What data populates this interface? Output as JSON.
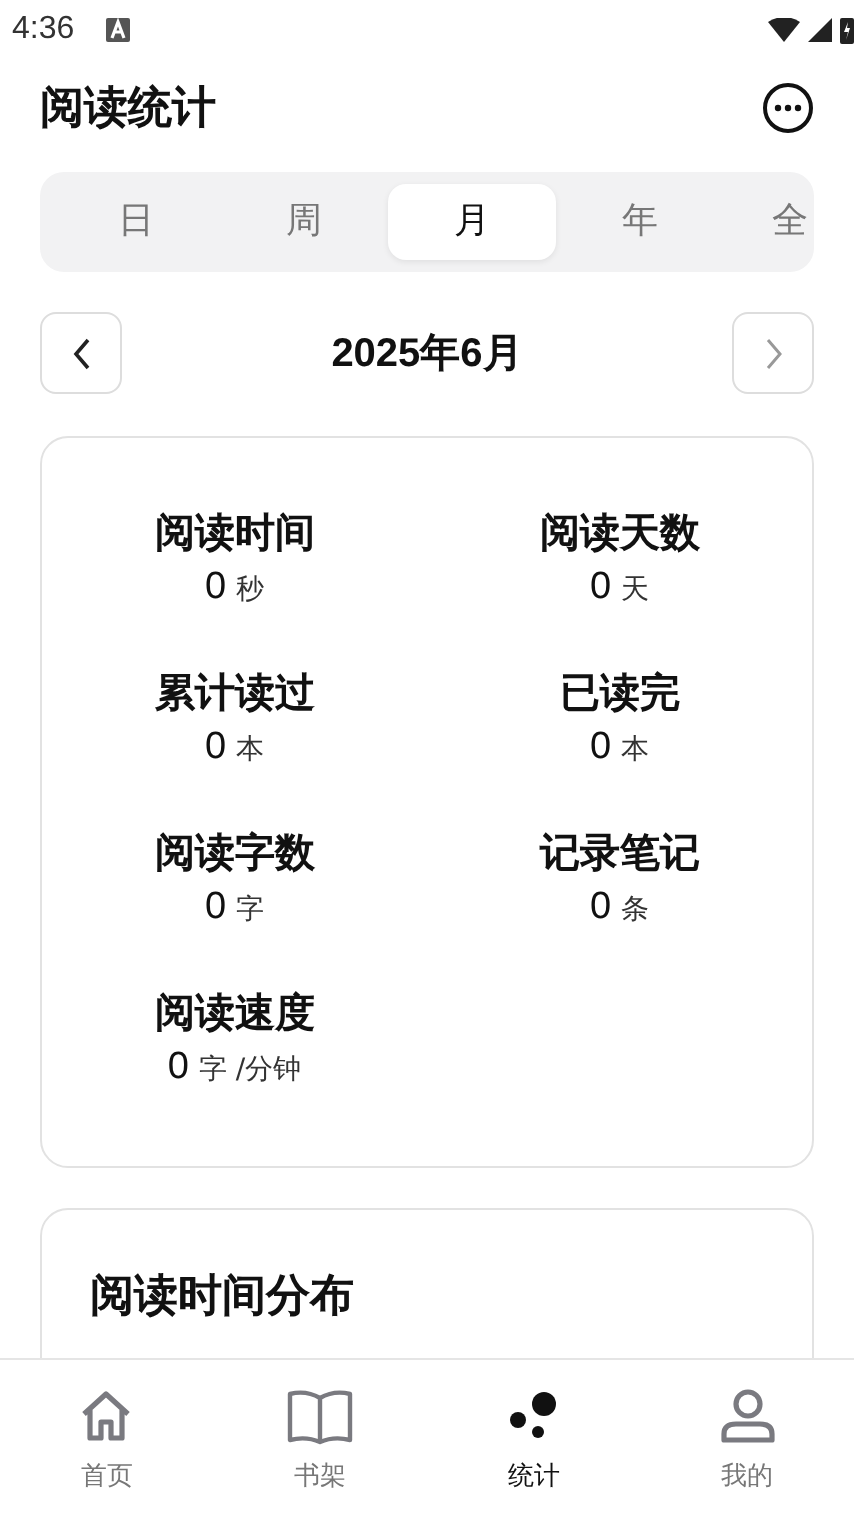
{
  "status_bar": {
    "time": "4:36"
  },
  "header": {
    "title": "阅读统计"
  },
  "period_tabs": [
    {
      "label": "日",
      "selected": false
    },
    {
      "label": "周",
      "selected": false
    },
    {
      "label": "月",
      "selected": true
    },
    {
      "label": "年",
      "selected": false
    },
    {
      "label": "全",
      "selected": false
    }
  ],
  "period_nav": {
    "title": "2025年6月"
  },
  "stats": [
    {
      "label": "阅读时间",
      "value": "0",
      "unit": "秒"
    },
    {
      "label": "阅读天数",
      "value": "0",
      "unit": "天"
    },
    {
      "label": "累计读过",
      "value": "0",
      "unit": "本"
    },
    {
      "label": "已读完",
      "value": "0",
      "unit": "本"
    },
    {
      "label": "阅读字数",
      "value": "0",
      "unit": "字"
    },
    {
      "label": "记录笔记",
      "value": "0",
      "unit": "条"
    },
    {
      "label": "阅读速度",
      "value": "0",
      "unit": "字 /分钟"
    }
  ],
  "distribution_card": {
    "title": "阅读时间分布"
  },
  "bottom_nav": [
    {
      "label": "首页",
      "kind": "home",
      "selected": false
    },
    {
      "label": "书架",
      "kind": "shelf",
      "selected": false
    },
    {
      "label": "统计",
      "kind": "stats",
      "selected": true
    },
    {
      "label": "我的",
      "kind": "profile",
      "selected": false
    }
  ]
}
